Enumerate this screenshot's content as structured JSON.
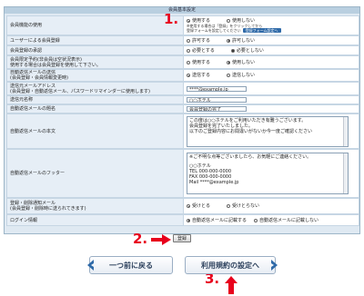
{
  "panel": {
    "title": "会員基本設定"
  },
  "rows": {
    "member_function": {
      "label": "会員機能の使用",
      "opt_on": "使用する",
      "opt_off": "使用しない",
      "note1": "※使用する場合は「登録」をクリックしてから",
      "note2": "登録フォームを設定してください",
      "link_label": "登録フォーム設定へ"
    },
    "user_registration": {
      "label": "ユーザーによる会員登録",
      "opt_on": "許可する",
      "opt_off": "許可しない"
    },
    "approval": {
      "label": "会員登録の承認",
      "opt_on": "必要とする",
      "opt_off": "必要としない"
    },
    "reservation": {
      "label_line1": "会員限定予約(非会員は空状況表示)",
      "label_line2": "使用する場合は会員登録を使用して下さい。",
      "opt_on": "使用する",
      "opt_off": "使用しない"
    },
    "auto_mail": {
      "label": "自動返信メールの送信",
      "label_sub": "(会員登録・会員情報変更時)",
      "opt_on": "送信する",
      "opt_off": "送信しない"
    },
    "sender_address": {
      "label": "送信元メールアドレス",
      "label_sub": "(会員登録・自動返信メール、パスワードリマインダーに使用します)",
      "value": "****@example.jp"
    },
    "sender_name": {
      "label": "送信元名称",
      "value": "○○ホテル"
    },
    "mail_subject": {
      "label": "自動返信メールの題名",
      "value": "会員登録の完了"
    },
    "mail_body": {
      "label": "自動返信メールの本文",
      "line1": "この度は○○ホテルをご利用いただき有難うございます。",
      "line2": "会員登録を完了いたしました。",
      "line3": "以下のご登録内容にお間違いがないか今一度ご確認ください"
    },
    "mail_footer": {
      "label": "自動返信メールのフッター",
      "line1": "※ご不明な点等ございましたら、お気軽にご連絡ください。",
      "line2": "○○ホテル",
      "line3": "TEL 000-000-0000",
      "line4": "FAX 000-000-0000",
      "line5": "Mail ****@example.jp"
    },
    "notice": {
      "label_line1": "登録・削除通知メール",
      "label_line2": "(会員登録・削除時に送られてきます)",
      "opt_on": "受けとる",
      "opt_off": "受けとらない"
    },
    "login_info": {
      "label": "ログイン情報",
      "opt_on": "自動返信メールに記載する",
      "opt_off": "自動返信メールに記載しない"
    }
  },
  "buttons": {
    "submit": "登録",
    "back": "一つ前に戻る",
    "next": "利用規約の設定へ"
  },
  "steps": {
    "s1": "1.",
    "s2": "2.",
    "s3": "3."
  },
  "colors": {
    "step_red": "#e8001c",
    "panel_bg": "#dfe9f2",
    "nav_chevron": "#2f6aa8"
  }
}
